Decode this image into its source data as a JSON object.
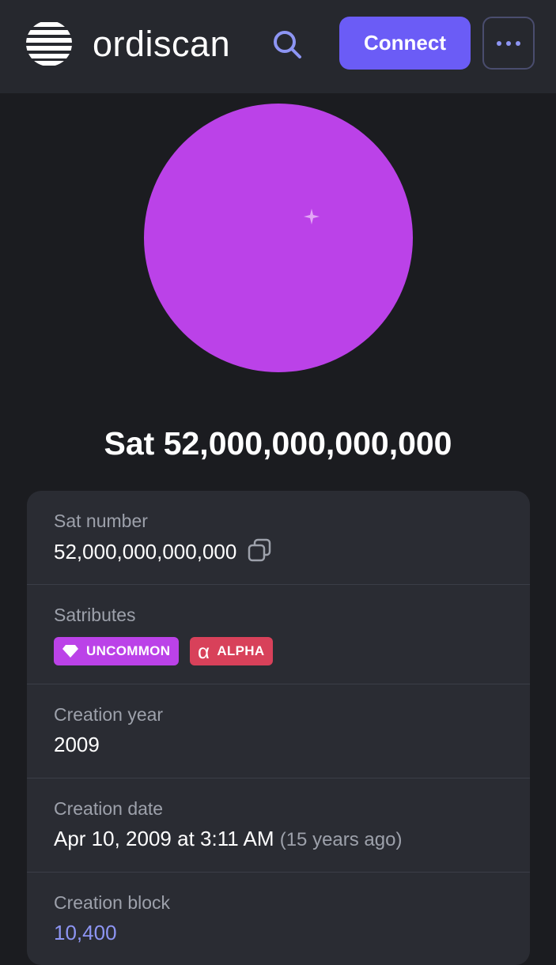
{
  "header": {
    "logo_text": "ordiscan",
    "connect_label": "Connect"
  },
  "sat": {
    "title": "Sat 52,000,000,000,000",
    "image_color": "#bb42e8"
  },
  "details": {
    "sat_number": {
      "label": "Sat number",
      "value": "52,000,000,000,000"
    },
    "satributes": {
      "label": "Satributes",
      "badges": [
        {
          "label": "UNCOMMON",
          "icon": "diamond-icon",
          "color": "#bb42e8"
        },
        {
          "label": "ALPHA",
          "icon": "alpha-icon",
          "color": "#d8415a"
        }
      ]
    },
    "creation_year": {
      "label": "Creation year",
      "value": "2009"
    },
    "creation_date": {
      "label": "Creation date",
      "value": "Apr 10, 2009 at 3:11 AM",
      "relative": "(15 years ago)"
    },
    "creation_block": {
      "label": "Creation block",
      "value": "10,400"
    }
  },
  "colors": {
    "accent": "#6b5cf6",
    "link": "#8d95f3",
    "background": "#1b1c20",
    "card": "#2a2c33"
  }
}
